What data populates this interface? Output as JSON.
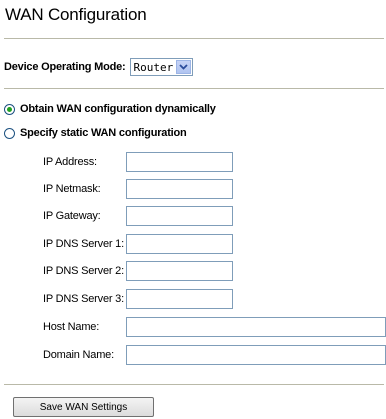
{
  "page": {
    "title": "WAN Configuration"
  },
  "mode": {
    "label": "Device Operating Mode:",
    "selected": "Router"
  },
  "options": {
    "dynamic": {
      "label": "Obtain WAN configuration dynamically",
      "checked": true
    },
    "static": {
      "label": "Specify static WAN configuration",
      "checked": false
    }
  },
  "fields": {
    "ip_address": {
      "label": "IP Address:",
      "value": ""
    },
    "ip_netmask": {
      "label": "IP Netmask:",
      "value": ""
    },
    "ip_gateway": {
      "label": "IP Gateway:",
      "value": ""
    },
    "dns1": {
      "label": "IP DNS Server 1:",
      "value": ""
    },
    "dns2": {
      "label": "IP DNS Server 2:",
      "value": ""
    },
    "dns3": {
      "label": "IP DNS Server 3:",
      "value": ""
    },
    "host_name": {
      "label": "Host Name:",
      "value": ""
    },
    "domain_name": {
      "label": "Domain Name:",
      "value": ""
    }
  },
  "actions": {
    "save_label": "Save WAN Settings"
  },
  "icons": {
    "dropdown": "chevron-down-icon"
  },
  "colors": {
    "radio_checked": "#21a121",
    "divider": "#b9b9a8",
    "input_border": "#7f9db9"
  }
}
